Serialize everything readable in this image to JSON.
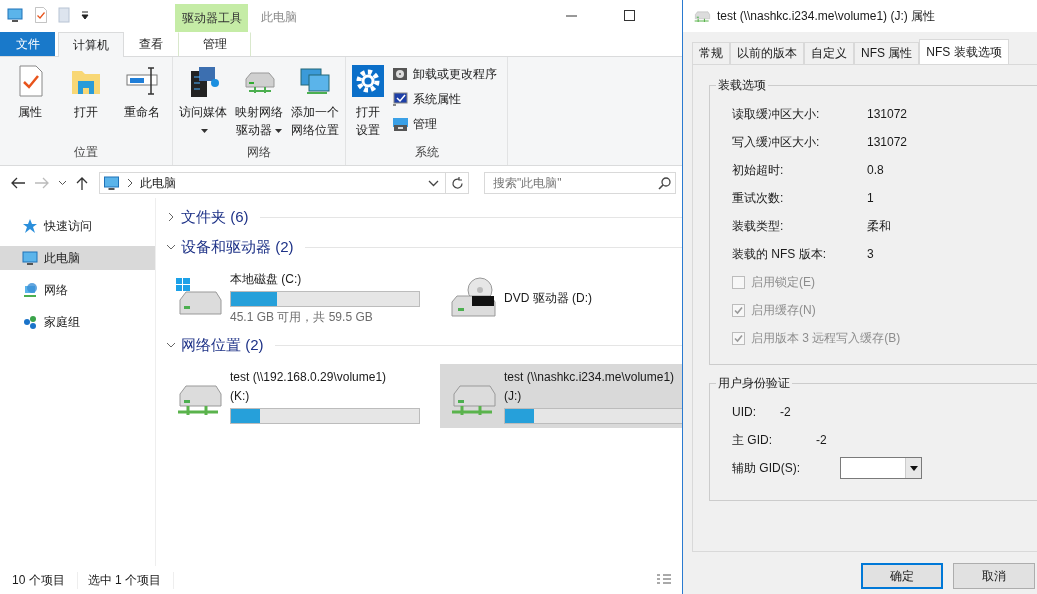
{
  "explorer": {
    "context_tab": "驱动器工具",
    "title": "此电脑",
    "ribbon_tabs": [
      {
        "label": "文件",
        "kind": "file",
        "selected": false
      },
      {
        "label": "计算机",
        "kind": "tab",
        "selected": true
      },
      {
        "label": "查看",
        "kind": "tab",
        "selected": false
      },
      {
        "label": "管理",
        "kind": "context",
        "selected": false
      }
    ],
    "ribbon_groups": [
      {
        "label": "位置",
        "buttons": [
          {
            "label": "属性",
            "dropdown": false
          },
          {
            "label": "打开",
            "dropdown": false
          },
          {
            "label": "重命名",
            "dropdown": false
          }
        ]
      },
      {
        "label": "网络",
        "buttons": [
          {
            "label": "访问媒体",
            "dropdown": true
          },
          {
            "label": "映射网络驱动器",
            "dropdown": true
          },
          {
            "label": "添加一个网络位置",
            "dropdown": false
          }
        ]
      },
      {
        "label": "系统",
        "buttons": [
          {
            "label": "打开设置",
            "dropdown": false
          }
        ],
        "small_buttons": [
          {
            "label": "卸载或更改程序"
          },
          {
            "label": "系统属性"
          },
          {
            "label": "管理"
          }
        ]
      }
    ],
    "address": "此电脑",
    "search": {
      "placeholder": "搜索\"此电脑\""
    },
    "nav_items": [
      {
        "label": "快速访问",
        "selected": false
      },
      {
        "label": "此电脑",
        "selected": true
      },
      {
        "label": "网络",
        "selected": false
      },
      {
        "label": "家庭组",
        "selected": false
      }
    ],
    "sections": [
      {
        "title": "文件夹 (6)",
        "expanded": false
      },
      {
        "title": "设备和驱动器 (2)",
        "expanded": true,
        "items": [
          {
            "kind": "disk",
            "name": "本地磁盘 (C:)",
            "level": 0.245,
            "detail": "45.1 GB 可用，共 59.5 GB",
            "selected": false
          },
          {
            "kind": "dvd",
            "name": "DVD 驱动器 (D:)",
            "selected": false
          }
        ]
      },
      {
        "title": "网络位置 (2)",
        "expanded": true,
        "items": [
          {
            "kind": "network",
            "name": "test (\\\\192.168.0.29\\volume1)",
            "drive": "(K:)",
            "level": 0.155,
            "selected": false
          },
          {
            "kind": "network",
            "name": "test (\\\\nashkc.i234.me\\volume1)",
            "drive": "(J:)",
            "level": 0.155,
            "selected": true
          }
        ]
      }
    ],
    "status": [
      "10 个项目",
      "选中 1 个项目"
    ]
  },
  "dialog": {
    "title": "test (\\\\nashkc.i234.me\\volume1) (J:) 属性",
    "tabs": [
      {
        "label": "常规",
        "selected": false
      },
      {
        "label": "以前的版本",
        "selected": false
      },
      {
        "label": "自定义",
        "selected": false
      },
      {
        "label": "NFS 属性",
        "selected": false
      },
      {
        "label": "NFS 装载选项",
        "selected": true
      }
    ],
    "mount_options": {
      "title": "装载选项",
      "fields": [
        {
          "label": "读取缓冲区大小:",
          "value": "131072"
        },
        {
          "label": "写入缓冲区大小:",
          "value": "131072"
        },
        {
          "label": "初始超时:",
          "value": "0.8"
        },
        {
          "label": "重试次数:",
          "value": "1"
        },
        {
          "label": "装载类型:",
          "value": "柔和"
        },
        {
          "label": "装载的 NFS 版本:",
          "value": "3"
        }
      ],
      "checkboxes": [
        {
          "label": "启用锁定(E)",
          "checked": false,
          "disabled": true
        },
        {
          "label": "启用缓存(N)",
          "checked": true,
          "disabled": true
        },
        {
          "label": "启用版本 3 远程写入缓存(B)",
          "checked": true,
          "disabled": true
        }
      ]
    },
    "auth": {
      "title": "用户身份验证",
      "fields": [
        {
          "label": "UID:",
          "value": "-2"
        },
        {
          "label": "主 GID:",
          "value": "-2"
        }
      ],
      "combo_label": "辅助 GID(S):"
    },
    "buttons": [
      {
        "label": "确定",
        "kind": "default"
      },
      {
        "label": "取消",
        "kind": "normal"
      }
    ]
  }
}
